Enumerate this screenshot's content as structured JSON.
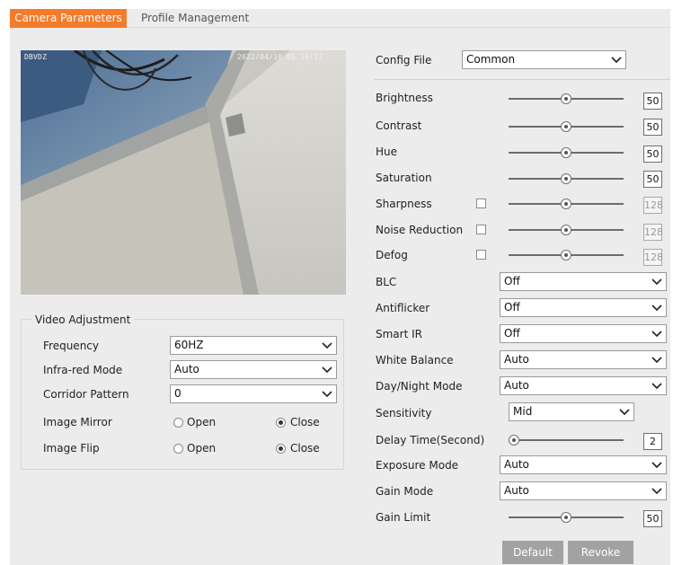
{
  "tabs": [
    {
      "label": "Camera Parameters",
      "active": true
    },
    {
      "label": "Profile Management",
      "active": false
    }
  ],
  "video": {
    "osd_left": "DBVDZ",
    "osd_right": "2022/04/10 05:16:12"
  },
  "video_adjustment": {
    "title": "Video Adjustment",
    "frequency": {
      "label": "Frequency",
      "value": "60HZ"
    },
    "infrared": {
      "label": "Infra-red Mode",
      "value": "Auto"
    },
    "corridor": {
      "label": "Corridor Pattern",
      "value": "0"
    },
    "mirror": {
      "label": "Image Mirror",
      "open": "Open",
      "close": "Close",
      "selected": "Close"
    },
    "flip": {
      "label": "Image Flip",
      "open": "Open",
      "close": "Close",
      "selected": "Close"
    }
  },
  "config": {
    "label": "Config File",
    "value": "Common"
  },
  "sliders": {
    "brightness": {
      "label": "Brightness",
      "value": "50",
      "level": 50
    },
    "contrast": {
      "label": "Contrast",
      "value": "50",
      "level": 50
    },
    "hue": {
      "label": "Hue",
      "value": "50",
      "level": 50
    },
    "saturation": {
      "label": "Saturation",
      "value": "50",
      "level": 50
    },
    "sharpness": {
      "label": "Sharpness",
      "value": "128",
      "level": 50
    },
    "noise": {
      "label": "Noise Reduction",
      "value": "128",
      "level": 50
    },
    "defog": {
      "label": "Defog",
      "value": "128",
      "level": 50
    },
    "delay": {
      "label": "Delay Time(Second)",
      "value": "2",
      "level": 5
    },
    "gain_limit": {
      "label": "Gain Limit",
      "value": "50",
      "level": 50
    }
  },
  "selects": {
    "blc": {
      "label": "BLC",
      "value": "Off"
    },
    "antiflicker": {
      "label": "Antiflicker",
      "value": "Off"
    },
    "smart_ir": {
      "label": "Smart IR",
      "value": "Off"
    },
    "white_balance": {
      "label": "White Balance",
      "value": "Auto"
    },
    "day_night": {
      "label": "Day/Night Mode",
      "value": "Auto"
    },
    "sensitivity": {
      "label": "Sensitivity",
      "value": "Mid"
    },
    "exposure": {
      "label": "Exposure Mode",
      "value": "Auto"
    },
    "gain_mode": {
      "label": "Gain Mode",
      "value": "Auto"
    }
  },
  "buttons": {
    "default": "Default",
    "revoke": "Revoke"
  },
  "colors": {
    "accent": "#f47b2a",
    "panel": "#ececec",
    "button": "#a2a2a2"
  }
}
